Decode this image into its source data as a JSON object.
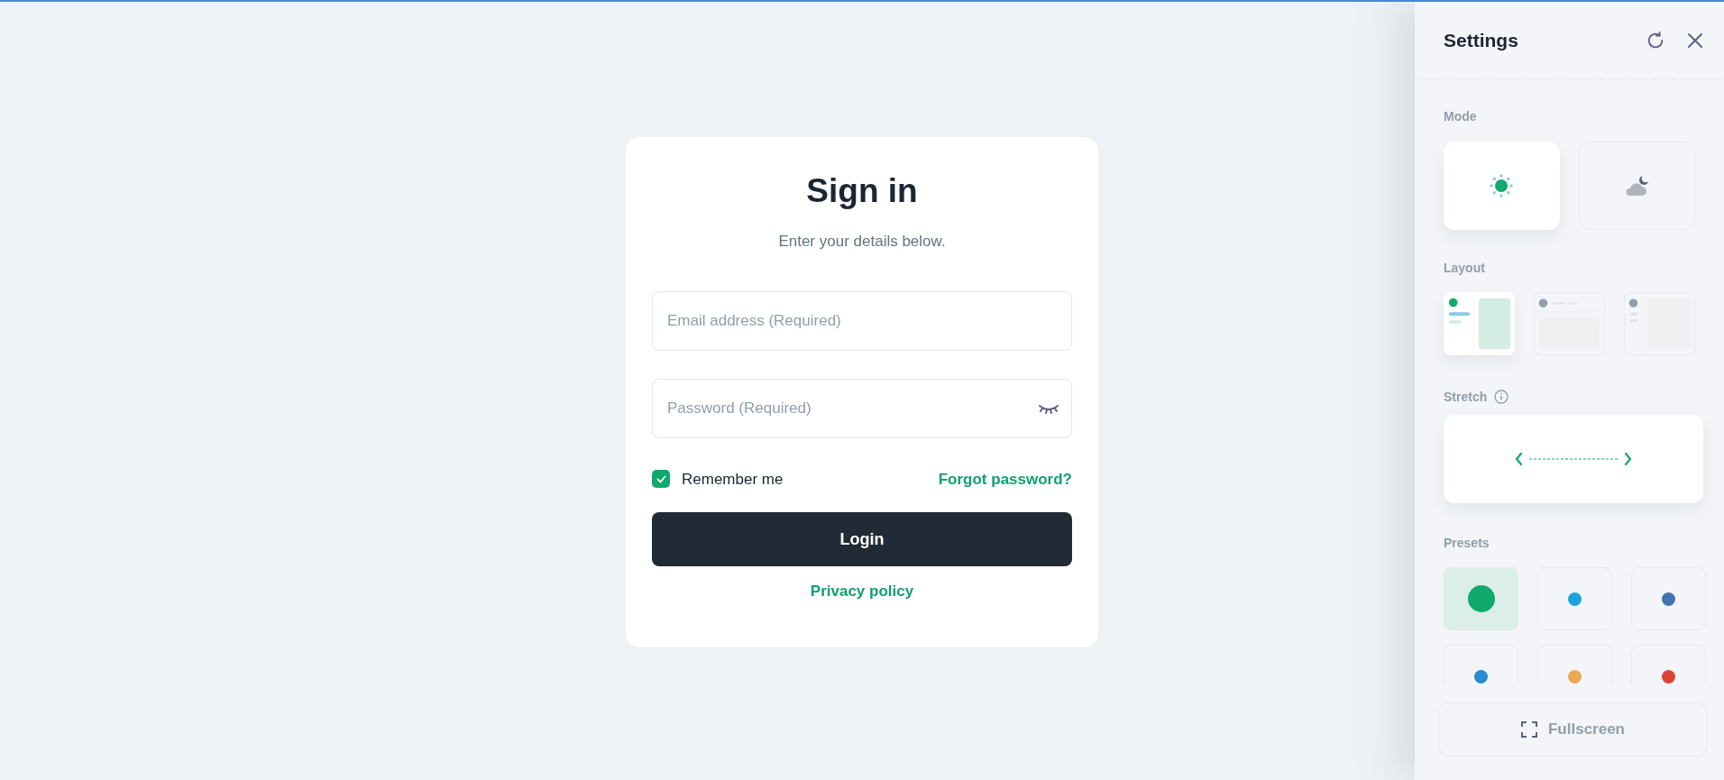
{
  "sign_in": {
    "title": "Sign in",
    "subtitle": "Enter your details below.",
    "email": {
      "placeholder": "Email address (Required)"
    },
    "password": {
      "placeholder": "Password (Required)",
      "revealed": false
    },
    "remember": {
      "label": "Remember me",
      "checked": true
    },
    "forgot_link": "Forgot password?",
    "login_button": "Login",
    "privacy_link": "Privacy policy"
  },
  "settings": {
    "title": "Settings",
    "mode": {
      "label": "Mode",
      "options": [
        {
          "kind": "light",
          "selected": true
        },
        {
          "kind": "dark",
          "selected": false
        }
      ]
    },
    "layout": {
      "label": "Layout",
      "options": [
        {
          "kind": "vertical",
          "selected": true
        },
        {
          "kind": "horizontal",
          "selected": false
        },
        {
          "kind": "mini",
          "selected": false
        }
      ]
    },
    "stretch": {
      "label": "Stretch",
      "on": false
    },
    "presets": {
      "label": "Presets",
      "items": [
        {
          "color": "#10a96e",
          "selected": true
        },
        {
          "color": "#1ca3de",
          "selected": false
        },
        {
          "color": "#4572b0",
          "selected": false
        },
        {
          "color": "#2a8bd2",
          "selected": false
        },
        {
          "color": "#e8aa52",
          "selected": false
        },
        {
          "color": "#dc4534",
          "selected": false
        }
      ]
    },
    "fullscreen_button": "Fullscreen"
  }
}
